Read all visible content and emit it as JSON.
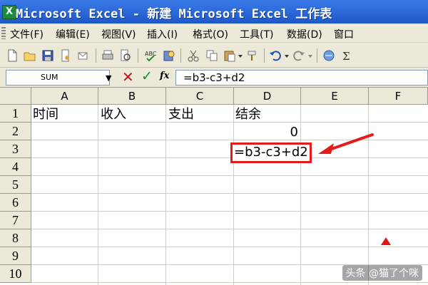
{
  "window": {
    "title": "Microsoft Excel - 新建 Microsoft Excel 工作表",
    "app_icon": "excel-icon"
  },
  "menu": [
    {
      "label": "文件(F)"
    },
    {
      "label": "编辑(E)"
    },
    {
      "label": "视图(V)"
    },
    {
      "label": "插入(I)"
    },
    {
      "label": "格式(O)"
    },
    {
      "label": "工具(T)"
    },
    {
      "label": "数据(D)"
    },
    {
      "label": "窗口"
    }
  ],
  "formula_bar": {
    "name_box": "SUM",
    "cancel_icon": "✕",
    "enter_icon": "✓",
    "fx_label": "fx",
    "formula": "=b3-c3+d2"
  },
  "sheet": {
    "columns": [
      "A",
      "B",
      "C",
      "D",
      "E",
      "F"
    ],
    "rows": [
      "1",
      "2",
      "3",
      "4",
      "5",
      "6",
      "7",
      "8",
      "9",
      "10"
    ],
    "cells": {
      "A1": "时间",
      "B1": "收入",
      "C1": "支出",
      "D1": "结余",
      "D2": "0",
      "D3": "=b3-c3+d2"
    }
  },
  "annotation": {
    "arrow_color": "#e31b1b"
  },
  "watermark": "头条 @猫了个咪"
}
